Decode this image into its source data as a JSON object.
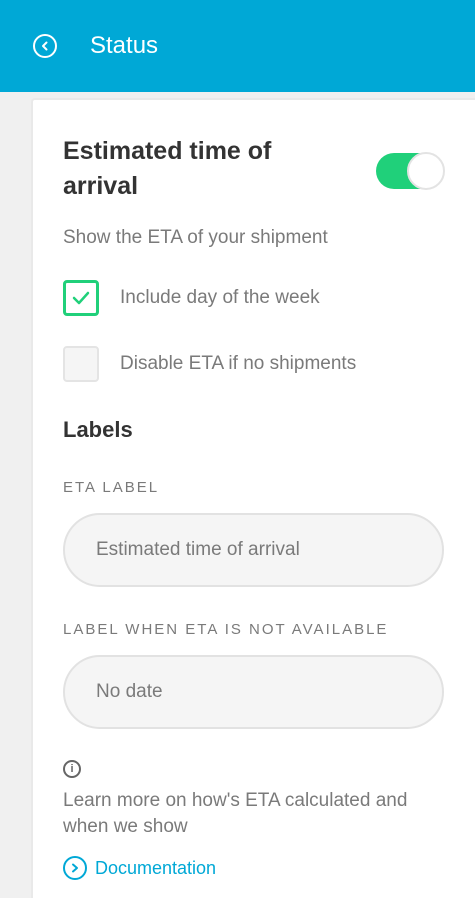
{
  "header": {
    "back_icon": "chevron-left-circle-icon",
    "title": "Status",
    "color": "#00a8d6"
  },
  "eta": {
    "title": "Estimated time of arrival",
    "enabled": true,
    "toggle_color": "#20d07a",
    "description": "Show the ETA of your shipment",
    "options": [
      {
        "label": "Include day of the week",
        "checked": true
      },
      {
        "label": "Disable ETA if no shipments",
        "checked": false
      }
    ]
  },
  "labels": {
    "heading": "Labels",
    "eta_label": {
      "caption": "ETA LABEL",
      "placeholder": "Estimated time of arrival"
    },
    "unavailable_label": {
      "caption": "LABEL WHEN ETA IS NOT AVAILABLE",
      "placeholder": "No date"
    }
  },
  "info": {
    "icon": "info-icon",
    "text": "Learn more on how's ETA calculated and when we show",
    "link_icon": "chevron-right-circle-icon",
    "link_label": "Documentation"
  }
}
